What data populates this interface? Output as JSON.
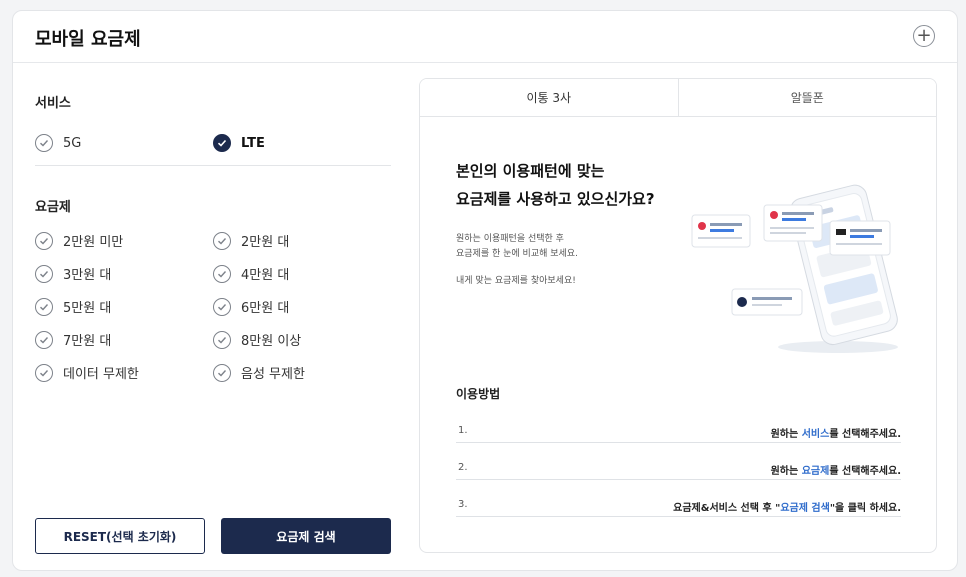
{
  "header": {
    "title": "모바일 요금제",
    "expand_symbol": "+"
  },
  "service": {
    "title": "서비스",
    "options": [
      {
        "label": "5G",
        "checked": false
      },
      {
        "label": "LTE",
        "checked": true
      }
    ]
  },
  "plans": {
    "title": "요금제",
    "options": [
      {
        "label": "2만원 미만",
        "checked": false
      },
      {
        "label": "2만원 대",
        "checked": false
      },
      {
        "label": "3만원 대",
        "checked": false
      },
      {
        "label": "4만원 대",
        "checked": false
      },
      {
        "label": "5만원 대",
        "checked": false
      },
      {
        "label": "6만원 대",
        "checked": false
      },
      {
        "label": "7만원 대",
        "checked": false
      },
      {
        "label": "8만원 이상",
        "checked": false
      },
      {
        "label": "데이터 무제한",
        "checked": false
      },
      {
        "label": "음성 무제한",
        "checked": false
      }
    ]
  },
  "buttons": {
    "reset": "RESET(선택 초기화)",
    "search": "요금제 검색"
  },
  "tabs": [
    {
      "label": "이통 3사",
      "active": true
    },
    {
      "label": "알뜰폰",
      "active": false
    }
  ],
  "info": {
    "headline_1": "본인의 이용패턴에 맞는",
    "headline_2": "요금제를 사용하고 있으신가요?",
    "desc_1": "원하는 이용패턴을 선택한 후",
    "desc_2": "요금제를 한 눈에 비교해 보세요.",
    "desc_3": "내게 맞는 요금제를 찾아보세요!"
  },
  "usage": {
    "title": "이용방법",
    "steps": [
      {
        "num": "1.",
        "pre": "원하는 ",
        "hl": "서비스",
        "post": "를 선택해주세요."
      },
      {
        "num": "2.",
        "pre": "원하는 ",
        "hl": "요금제",
        "post": "를 선택해주세요."
      },
      {
        "num": "3.",
        "pre": "요금제&서비스 선택 후 \"",
        "hl": "요금제 검색",
        "post": "\"을 클릭 하세요."
      }
    ]
  },
  "colors": {
    "primary": "#1c2a4d",
    "highlight": "#2f6ccb"
  }
}
